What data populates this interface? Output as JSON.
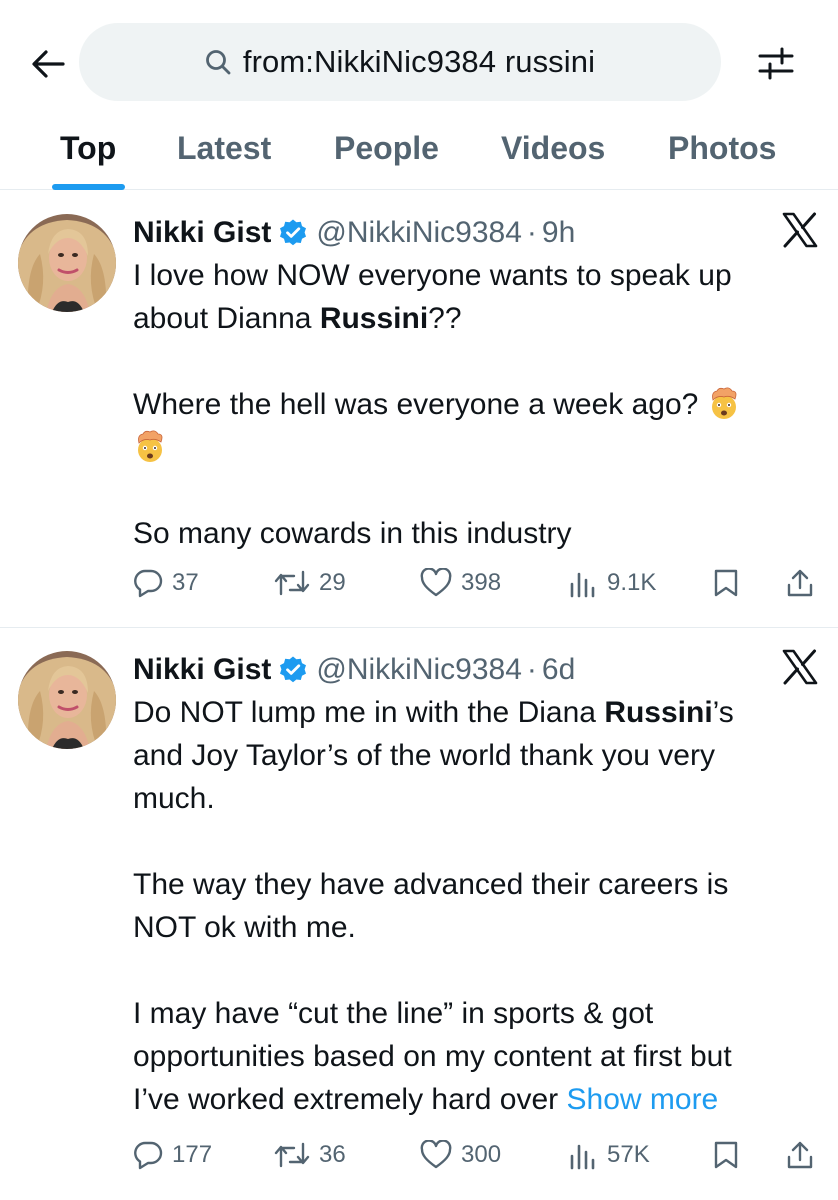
{
  "search": {
    "query": "from:NikkiNic9384 russini"
  },
  "tabs": [
    {
      "label": "Top",
      "active": true
    },
    {
      "label": "Latest",
      "active": false
    },
    {
      "label": "People",
      "active": false
    },
    {
      "label": "Videos",
      "active": false
    },
    {
      "label": "Photos",
      "active": false
    }
  ],
  "tweets": [
    {
      "name": "Nikki Gist",
      "handle": "@NikkiNic9384",
      "separator": "·",
      "time": "9h",
      "lines": {
        "l1": "I love how NOW everyone wants to speak up",
        "l2a": "about Dianna ",
        "l2b": "Russini",
        "l2c": "??",
        "l3": "Where the hell was everyone a week ago? ",
        "l4": "So many cowards in this industry"
      },
      "emoji_icon": "exploding-head-emoji",
      "stats": {
        "replies": "37",
        "reposts": "29",
        "likes": "398",
        "views": "9.1K"
      }
    },
    {
      "name": "Nikki Gist",
      "handle": "@NikkiNic9384",
      "separator": "·",
      "time": "6d",
      "lines": {
        "l1a": "Do NOT lump me in with the Diana ",
        "l1b": "Russini",
        "l1c": "’s",
        "l2": "and Joy Taylor’s of the world thank you very",
        "l3": "much.",
        "l4": "The way they have advanced their careers is",
        "l5": "NOT ok with me.",
        "l6": "I may have “cut the line” in sports & got",
        "l7": "opportunities based on my content at first but",
        "l8": "I’ve worked extremely hard over ",
        "show_more": "Show more"
      },
      "stats": {
        "replies": "177",
        "reposts": "36",
        "likes": "300",
        "views": "57K"
      }
    }
  ],
  "icons": [
    "back-arrow-icon",
    "search-icon",
    "filter-icon",
    "verified-badge-icon",
    "x-logo-icon",
    "reply-icon",
    "repost-icon",
    "like-icon",
    "views-icon",
    "bookmark-icon",
    "share-icon"
  ],
  "colors": {
    "accent": "#1d9bf0",
    "text": "#0f1419",
    "secondary": "#536471",
    "search_bg": "#eff3f4"
  }
}
